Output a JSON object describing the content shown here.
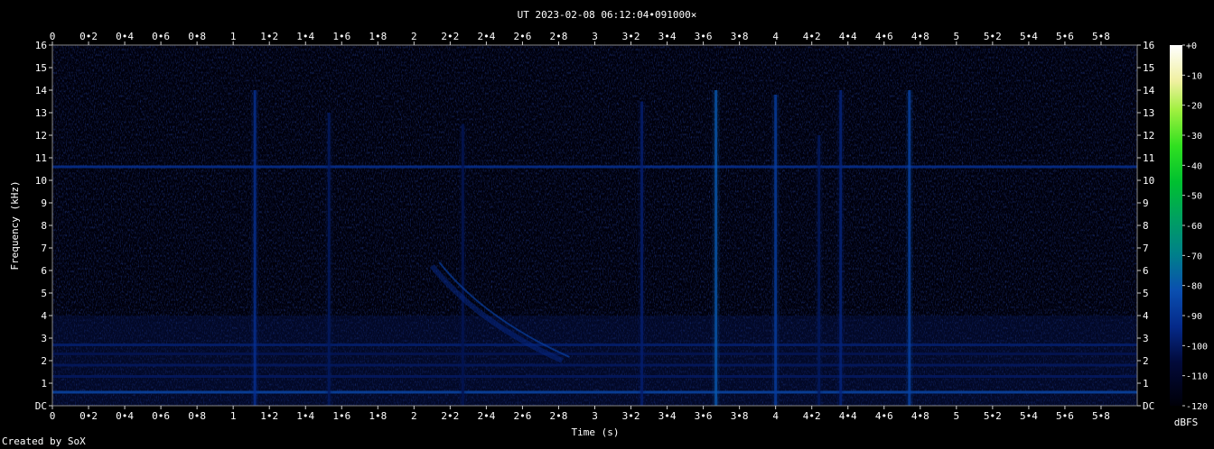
{
  "chart_data": {
    "type": "heatmap",
    "title": "UT 2023-02-08 06:12:04•091000×",
    "xlabel": "Time (s)",
    "ylabel": "Frequency (kHz)",
    "xlim": [
      0,
      6
    ],
    "ylim": [
      0,
      16
    ],
    "x_ticks": [
      "0",
      "0•2",
      "0•4",
      "0•6",
      "0•8",
      "1",
      "1•2",
      "1•4",
      "1•6",
      "1•8",
      "2",
      "2•2",
      "2•4",
      "2•6",
      "2•8",
      "3",
      "3•2",
      "3•4",
      "3•6",
      "3•8",
      "4",
      "4•2",
      "4•4",
      "4•6",
      "4•8",
      "5",
      "5•2",
      "5•4",
      "5•6",
      "5•8"
    ],
    "y_ticks": [
      "DC",
      "1",
      "2",
      "3",
      "4",
      "5",
      "6",
      "7",
      "8",
      "9",
      "10",
      "11",
      "12",
      "13",
      "14",
      "15",
      "16"
    ],
    "colorbar": {
      "label": "dBFS",
      "ticks": [
        "+0",
        "-10",
        "-20",
        "-30",
        "-40",
        "-50",
        "-60",
        "-70",
        "-80",
        "-90",
        "-100",
        "-110",
        "-120"
      ],
      "range": [
        -120,
        0
      ]
    },
    "horizontal_bands_khz": [
      {
        "freq": 0.6,
        "level": -85
      },
      {
        "freq": 1.3,
        "level": -100
      },
      {
        "freq": 1.8,
        "level": -100
      },
      {
        "freq": 2.3,
        "level": -102
      },
      {
        "freq": 2.7,
        "level": -98
      },
      {
        "freq": 10.6,
        "level": -92
      }
    ],
    "impulses": [
      {
        "time": 1.12,
        "fmax": 14.0,
        "level": -92
      },
      {
        "time": 1.53,
        "fmax": 13.0,
        "level": -100
      },
      {
        "time": 2.27,
        "fmax": 12.5,
        "level": -102
      },
      {
        "time": 3.26,
        "fmax": 13.5,
        "level": -98
      },
      {
        "time": 3.67,
        "fmax": 14.0,
        "level": -80
      },
      {
        "time": 4.0,
        "fmax": 13.8,
        "level": -88
      },
      {
        "time": 4.24,
        "fmax": 12.0,
        "level": -100
      },
      {
        "time": 4.36,
        "fmax": 14.0,
        "level": -96
      },
      {
        "time": 4.74,
        "fmax": 14.0,
        "level": -86
      }
    ],
    "sweep": {
      "t_start": 2.1,
      "f_start": 6.2,
      "t_end": 2.82,
      "f_end": 2.0,
      "level": -95
    },
    "credit": "Created by SoX"
  }
}
